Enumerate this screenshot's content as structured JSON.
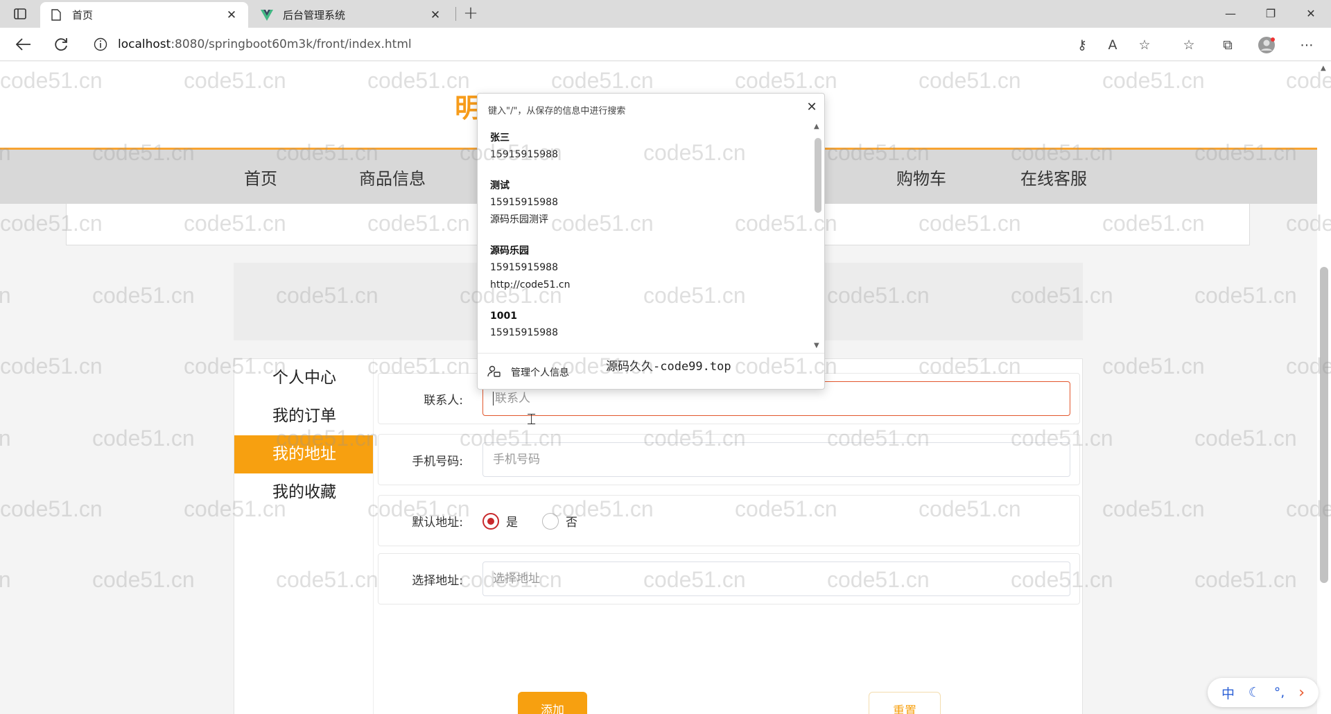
{
  "browser": {
    "tabs": [
      {
        "title": "首页",
        "active": true
      },
      {
        "title": "后台管理系统",
        "active": false
      }
    ],
    "url_host": "localhost",
    "url_path": ":8080/springboot60m3k/front/index.html"
  },
  "site": {
    "title_visible": "明"
  },
  "nav": {
    "items": [
      "首页",
      "商品信息",
      "购物车",
      "在线客服"
    ]
  },
  "side_menu": {
    "items": [
      "个人中心",
      "我的订单",
      "我的地址",
      "我的收藏"
    ],
    "active_index": 2
  },
  "form": {
    "contact": {
      "label": "联系人:",
      "placeholder": "联系人"
    },
    "phone": {
      "label": "手机号码:",
      "placeholder": "手机号码"
    },
    "default": {
      "label": "默认地址:",
      "yes": "是",
      "no": "否",
      "selected": "是"
    },
    "address": {
      "label": "选择地址:",
      "placeholder": "选择地址"
    },
    "add_label": "添加",
    "reset_label": "重置"
  },
  "autofill": {
    "hint": "键入\"/\"，从保存的信息中进行搜索",
    "entries": [
      {
        "name": "张三",
        "lines": [
          "15915915988"
        ]
      },
      {
        "name": "测试",
        "lines": [
          "15915915988",
          "源码乐园测评"
        ]
      },
      {
        "name": "源码乐园",
        "lines": [
          "15915915988",
          "http://code51.cn"
        ]
      },
      {
        "name": "1001",
        "lines": [
          "15915915988"
        ]
      }
    ],
    "manage_label": "管理个人信息",
    "overlay_text": "源码久久-code99.top"
  },
  "watermark": "code51.cn",
  "ime": {
    "lang": "中",
    "chevron": "›"
  },
  "colors": {
    "accent": "#f7a010",
    "radio_checked": "#c8282b",
    "focus_border": "#e2562c"
  }
}
